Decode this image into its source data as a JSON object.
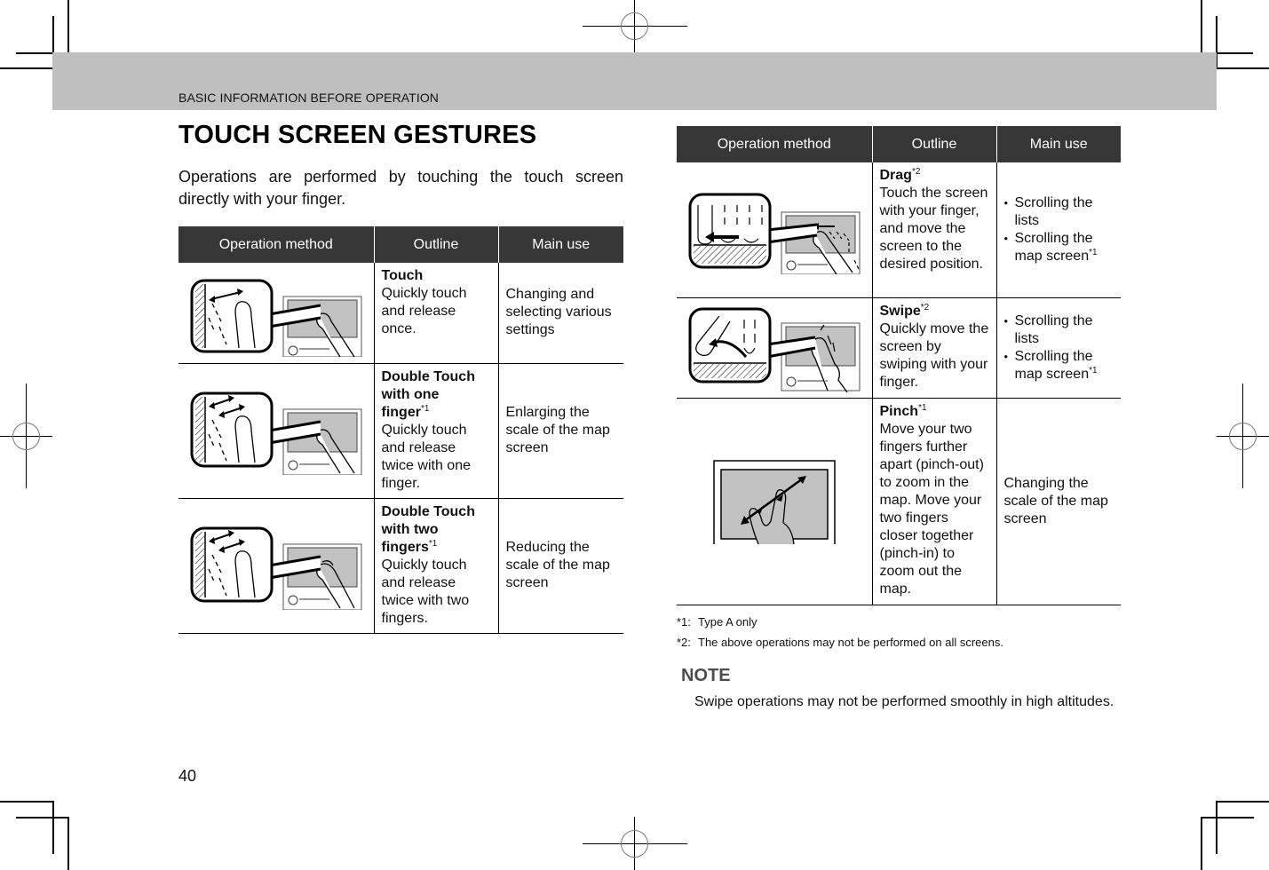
{
  "header": {
    "section": "BASIC INFORMATION BEFORE OPERATION"
  },
  "page": {
    "title": "TOUCH SCREEN GESTURES",
    "intro": "Operations are performed by touching the touch screen directly with your finger.",
    "number": "40"
  },
  "table_columns": [
    "Operation method",
    "Outline",
    "Main use"
  ],
  "left_table": {
    "rows": [
      {
        "illustration": "touch-gesture-illustration",
        "title": "Touch",
        "mark": "",
        "description": "Quickly touch and release once.",
        "main_use": "Changing and selecting various settings"
      },
      {
        "illustration": "double-touch-one-finger-illustration",
        "title": "Double Touch with one finger",
        "mark": "*1",
        "description": "Quickly touch and release twice with one finger.",
        "main_use": "Enlarging the scale of the map screen"
      },
      {
        "illustration": "double-touch-two-fingers-illustration",
        "title": "Double Touch with two fingers",
        "mark": "*1",
        "description": "Quickly touch and release twice with two fingers.",
        "main_use": "Reducing the scale of the map screen"
      }
    ]
  },
  "right_table": {
    "rows": [
      {
        "illustration": "drag-gesture-illustration",
        "title": "Drag",
        "mark": "*2",
        "description": "Touch the screen with your finger, and move the screen to the desired position.",
        "main_use_items": [
          {
            "text": "Scrolling the lists",
            "mark": ""
          },
          {
            "text": "Scrolling the map screen",
            "mark": "*1"
          }
        ]
      },
      {
        "illustration": "swipe-gesture-illustration",
        "title": "Swipe",
        "mark": "*2",
        "description": "Quickly move the screen by swiping with your finger.",
        "main_use_items": [
          {
            "text": "Scrolling the lists",
            "mark": ""
          },
          {
            "text": "Scrolling the map screen",
            "mark": "*1"
          }
        ]
      },
      {
        "illustration": "pinch-gesture-illustration",
        "title": "Pinch",
        "mark": "*1",
        "description": "Move your two fingers further apart (pinch-out) to zoom in the map. Move your two fingers closer together (pinch-in) to zoom out the map.",
        "main_use": "Changing the scale of the map screen"
      }
    ]
  },
  "footnotes": [
    {
      "mark": "*1:",
      "text": "Type A only"
    },
    {
      "mark": "*2:",
      "text": "The above operations may not be performed on all screens."
    }
  ],
  "note": {
    "heading": "NOTE",
    "body": "Swipe operations may not be performed smoothly in high altitudes."
  }
}
